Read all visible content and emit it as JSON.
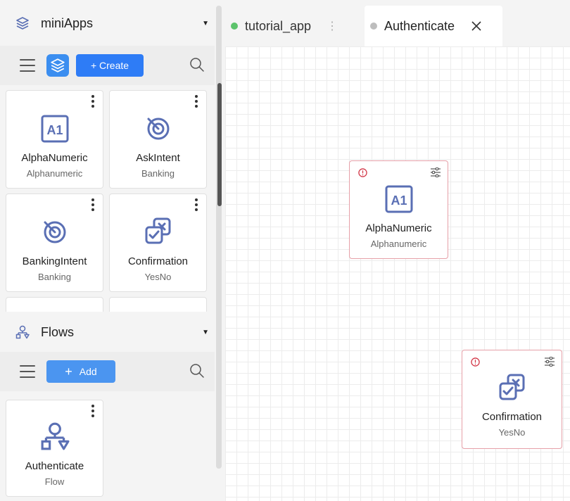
{
  "sidebar": {
    "miniapps": {
      "title": "miniApps",
      "create_label": "+ Create",
      "cards": [
        {
          "name": "AlphaNumeric",
          "type": "Alphanumeric",
          "icon": "alphanumeric-icon"
        },
        {
          "name": "AskIntent",
          "type": "Banking",
          "icon": "target-icon"
        },
        {
          "name": "BankingIntent",
          "type": "Banking",
          "icon": "target-icon"
        },
        {
          "name": "Confirmation",
          "type": "YesNo",
          "icon": "confirmation-icon"
        }
      ]
    },
    "flows": {
      "title": "Flows",
      "add_label": "Add",
      "cards": [
        {
          "name": "Authenticate",
          "type": "Flow",
          "icon": "flow-icon"
        }
      ]
    }
  },
  "tabs": [
    {
      "label": "tutorial_app",
      "status_color": "#5cc36b"
    },
    {
      "label": "Authenticate",
      "status_color": "#bdbdbd"
    }
  ],
  "canvas": {
    "nodes": [
      {
        "name": "AlphaNumeric",
        "type": "Alphanumeric",
        "icon": "alphanumeric-icon"
      },
      {
        "name": "Confirmation",
        "type": "YesNo",
        "icon": "confirmation-icon"
      }
    ]
  },
  "colors": {
    "accent": "#2e7cf6",
    "icon": "#5a6fb4",
    "error": "#d33a4a"
  }
}
